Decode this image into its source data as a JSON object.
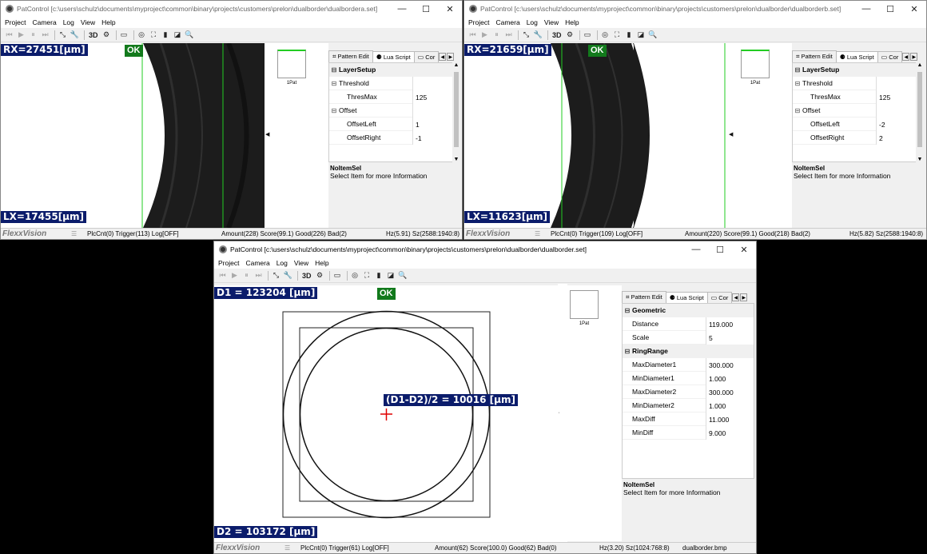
{
  "windows": {
    "a": {
      "title": "PatControl [c:\\users\\schulz\\documents\\myproject\\common\\binary\\projects\\customers\\prelon\\dualborder\\dualbordera.set]",
      "rx": "RX=27451[µm]",
      "lx": "LX=17455[µm]",
      "ok": "OK",
      "pattern_label": "1Pat",
      "properties": [
        {
          "name": "LayerSetup",
          "type": "cat"
        },
        {
          "name": "Threshold",
          "type": "group"
        },
        {
          "name": "ThresMax",
          "value": "125"
        },
        {
          "name": "Offset",
          "type": "group"
        },
        {
          "name": "OffsetLeft",
          "value": "1"
        },
        {
          "name": "OffsetRight",
          "value": "-1"
        }
      ],
      "status": {
        "plc": "PlcCnt(0) Trigger(113) Log[OFF]",
        "amount": "Amount(228) Score(99.1) Good(226) Bad(2)",
        "hz": "Hz(5.91) Sz(2588:1940:8)",
        "file": ""
      }
    },
    "b": {
      "title": "PatControl [c:\\users\\schulz\\documents\\myproject\\common\\binary\\projects\\customers\\prelon\\dualborder\\dualborderb.set]",
      "rx": "RX=21659[µm]",
      "lx": "LX=11623[µm]",
      "ok": "OK",
      "pattern_label": "1Pat",
      "properties": [
        {
          "name": "LayerSetup",
          "type": "cat"
        },
        {
          "name": "Threshold",
          "type": "group"
        },
        {
          "name": "ThresMax",
          "value": "125"
        },
        {
          "name": "Offset",
          "type": "group"
        },
        {
          "name": "OffsetLeft",
          "value": "-2"
        },
        {
          "name": "OffsetRight",
          "value": "2"
        }
      ],
      "status": {
        "plc": "PlcCnt(0) Trigger(109) Log[OFF]",
        "amount": "Amount(220) Score(99.1) Good(218) Bad(2)",
        "hz": "Hz(5.82) Sz(2588:1940:8)",
        "file": ""
      }
    },
    "c": {
      "title": "PatControl [c:\\users\\schulz\\documents\\myproject\\common\\binary\\projects\\customers\\prelon\\dualborder\\dualborder.set]",
      "d1": "D1 = 123204 [µm]",
      "d2": "D2 = 103172 [µm]",
      "diff": "(D1-D2)/2 = 10016 [µm]",
      "ok": "OK",
      "pattern_label": "1Pat",
      "properties": [
        {
          "name": "Geometric",
          "type": "cat"
        },
        {
          "name": "Distance",
          "value": "119.000"
        },
        {
          "name": "Scale",
          "value": "5"
        },
        {
          "name": "RingRange",
          "type": "cat"
        },
        {
          "name": "MaxDiameter1",
          "value": "300.000"
        },
        {
          "name": "MinDiameter1",
          "value": "1.000"
        },
        {
          "name": "MaxDiameter2",
          "value": "300.000"
        },
        {
          "name": "MinDiameter2",
          "value": "1.000"
        },
        {
          "name": "MaxDiff",
          "value": "11.000"
        },
        {
          "name": "MinDiff",
          "value": "9.000"
        }
      ],
      "status": {
        "plc": "PlcCnt(0) Trigger(61) Log[OFF]",
        "amount": "Amount(62) Score(100.0) Good(62) Bad(0)",
        "hz": "Hz(3.20) Sz(1024:768:8)",
        "file": "dualborder.bmp"
      }
    }
  },
  "menu": [
    "Project",
    "Camera",
    "Log",
    "View",
    "Help"
  ],
  "tabs": {
    "pattern_edit": "Pattern Edit",
    "lua_script": "Lua Script",
    "con": "Cor"
  },
  "info": {
    "title": "NoItemSel",
    "desc": "Select Item for more Information"
  },
  "brand": "FlexxVision",
  "window_controls": {
    "minimize": "—",
    "maximize": "☐",
    "close": "✕"
  },
  "toolbar_3d": "3D",
  "colors": {
    "readout_bg": "#0b1c6b",
    "ok_bg": "#127a1c",
    "marker": "#e00000",
    "guide_line": "#22cc22"
  }
}
